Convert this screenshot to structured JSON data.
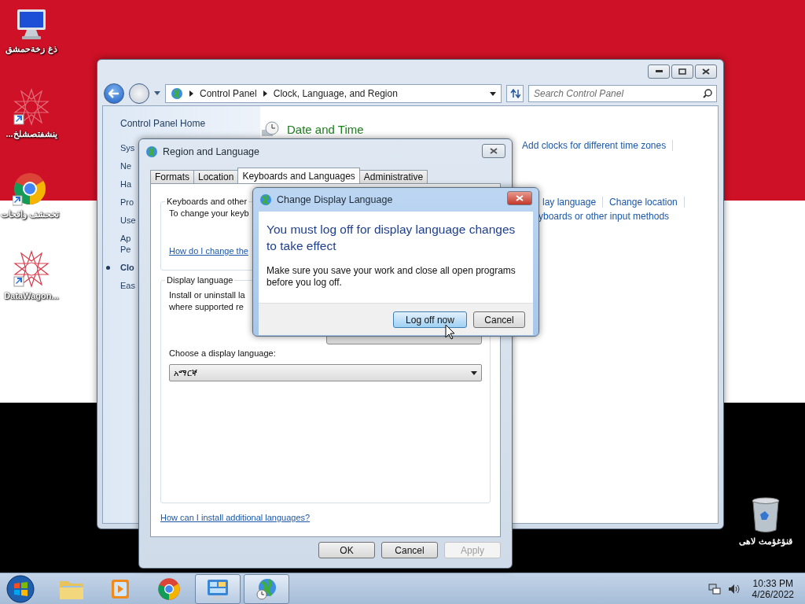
{
  "desktop": {
    "icons": [
      {
        "kind": "computer",
        "label": "ذغ زخةحمشق"
      },
      {
        "kind": "star-shortcut",
        "label": "...ينشفتصشلخ"
      },
      {
        "kind": "chrome-shortcut",
        "label": "تخحشف واقحات"
      },
      {
        "kind": "star-shortcut",
        "label": "DataWagon..."
      }
    ],
    "recycle_bin": {
      "label": "قنؤغؤمث لاهى"
    }
  },
  "control_panel": {
    "breadcrumb": [
      "Control Panel",
      "Clock, Language, and Region"
    ],
    "search": {
      "placeholder": "Search Control Panel"
    },
    "sidebar": {
      "home": "Control Panel Home",
      "items": [
        {
          "lines": [
            "Sys"
          ],
          "selected": false
        },
        {
          "lines": [
            "Ne"
          ],
          "selected": false
        },
        {
          "lines": [
            "Ha"
          ],
          "selected": false
        },
        {
          "lines": [
            "Pro"
          ],
          "selected": false
        },
        {
          "lines": [
            "Use"
          ],
          "selected": false
        },
        {
          "lines": [
            "Ap",
            "Pe"
          ],
          "selected": false
        },
        {
          "lines": [
            "Clo"
          ],
          "selected": true
        },
        {
          "lines": [
            "Eas"
          ],
          "selected": false
        }
      ]
    },
    "content": {
      "heading": "Date and Time",
      "link_lines": [
        [
          "Add clocks for different time zones"
        ],
        [
          "lay language",
          "Change location"
        ],
        [
          "yboards or other input methods"
        ]
      ]
    }
  },
  "region_dialog": {
    "title": "Region and Language",
    "tabs": [
      {
        "label": "Formats",
        "selected": false
      },
      {
        "label": "Location",
        "selected": false
      },
      {
        "label": "Keyboards and Languages",
        "selected": true
      },
      {
        "label": "Administrative",
        "selected": false
      }
    ],
    "keyboards_group": {
      "title": "Keyboards and other",
      "text": "To change your keyb",
      "link": "How do I change the"
    },
    "display_group": {
      "title": "Display language",
      "text_lines": [
        "Install or uninstall la",
        "where supported re"
      ],
      "choose_label": "Choose a display language:",
      "select_value": "አማርኛ"
    },
    "help_link": "How can I install additional languages?",
    "buttons": [
      {
        "label": "OK",
        "disabled": false
      },
      {
        "label": "Cancel",
        "disabled": false
      },
      {
        "label": "Apply",
        "disabled": true
      }
    ]
  },
  "change_dialog": {
    "title": "Change Display Language",
    "heading": "You must log off for display language changes to take effect",
    "body": "Make sure you save your work and close all open programs before you log off.",
    "buttons": [
      {
        "label": "Log off now",
        "selected": true
      },
      {
        "label": "Cancel",
        "selected": false
      }
    ]
  },
  "taskbar": {
    "items": [
      {
        "kind": "explorer",
        "active": false
      },
      {
        "kind": "media",
        "active": false
      },
      {
        "kind": "chrome",
        "active": false
      },
      {
        "kind": "control-panel",
        "active": true
      },
      {
        "kind": "globe",
        "active": true
      }
    ],
    "clock": {
      "time": "10:33 PM",
      "date": "4/26/2022"
    }
  }
}
